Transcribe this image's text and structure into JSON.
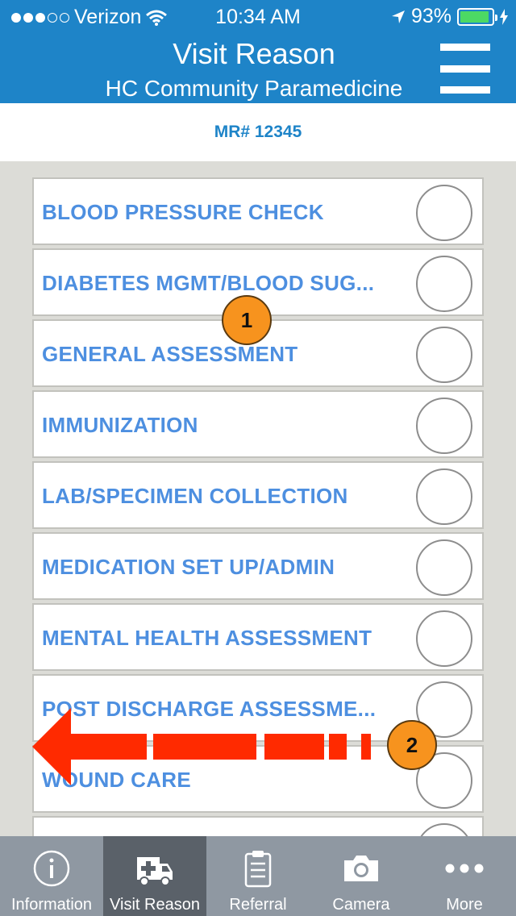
{
  "status_bar": {
    "carrier": "Verizon",
    "time": "10:34 AM",
    "battery": "93%",
    "battery_level": 0.93,
    "signal_bars_filled": 3,
    "signal_bars_total": 5
  },
  "header": {
    "title": "Visit Reason",
    "subtitle": "HC Community Paramedicine"
  },
  "record": {
    "mr_label": "MR# 12345"
  },
  "visit_reasons": [
    {
      "label": "BLOOD PRESSURE CHECK",
      "selected": false
    },
    {
      "label": "DIABETES MGMT/BLOOD SUG...",
      "selected": false
    },
    {
      "label": "GENERAL ASSESSMENT",
      "selected": false
    },
    {
      "label": "IMMUNIZATION",
      "selected": false
    },
    {
      "label": "LAB/SPECIMEN COLLECTION",
      "selected": false
    },
    {
      "label": "MEDICATION SET UP/ADMIN",
      "selected": false
    },
    {
      "label": "MENTAL HEALTH ASSESSMENT",
      "selected": false
    },
    {
      "label": "POST DISCHARGE ASSESSME...",
      "selected": false
    },
    {
      "label": "WOUND CARE",
      "selected": false
    },
    {
      "label": "",
      "selected": false
    }
  ],
  "annotations": {
    "badge_1": "1",
    "badge_2": "2",
    "arrow_color": "#ff2a00",
    "badge_color": "#f7931e"
  },
  "tabs": [
    {
      "label": "Information",
      "icon": "info-icon",
      "active": false
    },
    {
      "label": "Visit Reason",
      "icon": "ambulance-icon",
      "active": true
    },
    {
      "label": "Referral",
      "icon": "clipboard-icon",
      "active": false
    },
    {
      "label": "Camera",
      "icon": "camera-icon",
      "active": false
    },
    {
      "label": "More",
      "icon": "more-dots-icon",
      "active": false
    }
  ],
  "colors": {
    "primary": "#1e84c8",
    "item_text": "#4d8fe0",
    "tabbar": "#8f98a2",
    "tab_active": "#5a6169"
  }
}
